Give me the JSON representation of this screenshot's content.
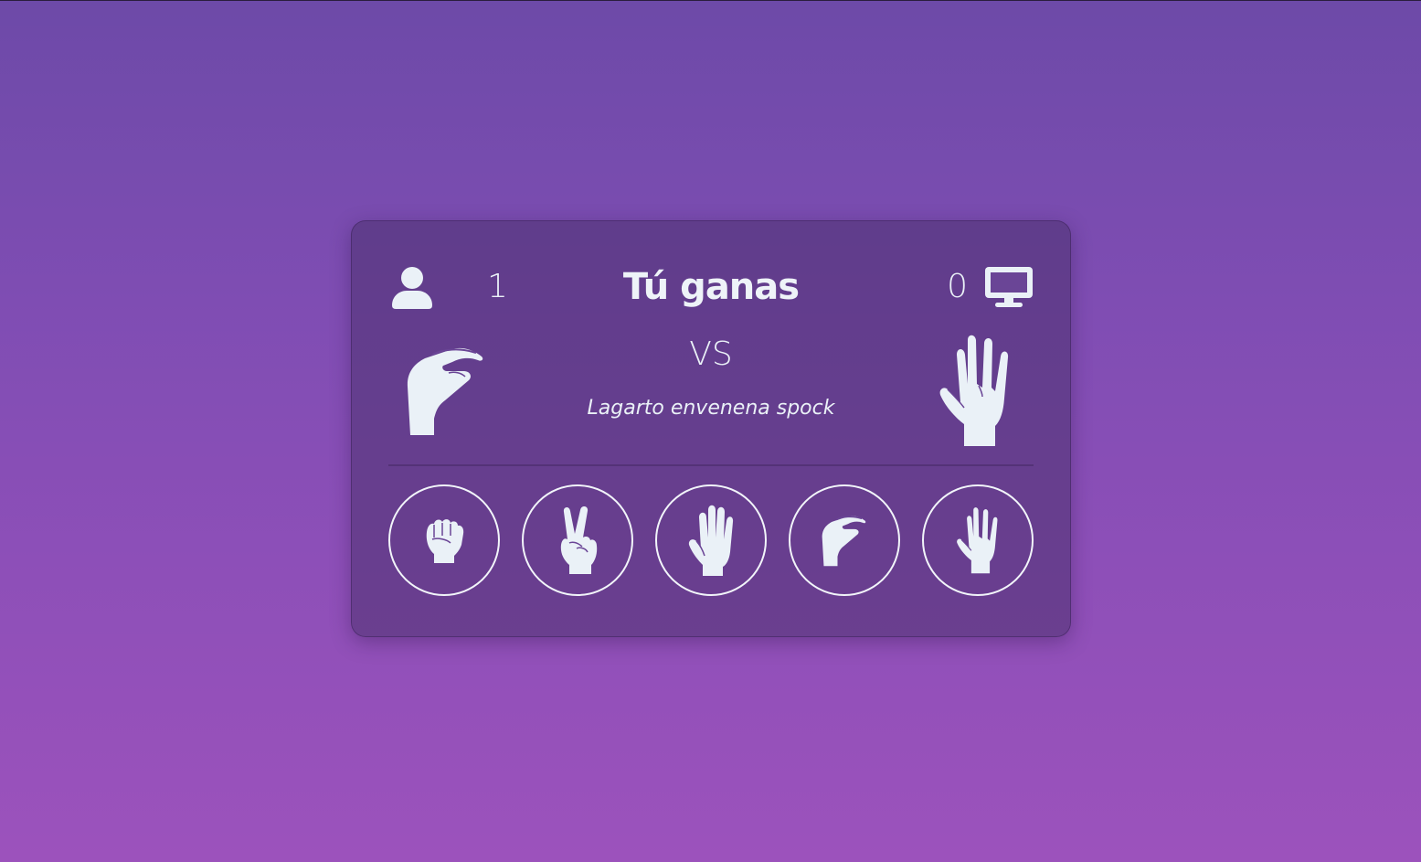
{
  "scoreboard": {
    "player_score": "1",
    "result_text": "Tú ganas",
    "cpu_score": "0",
    "player_icon": "user-icon",
    "cpu_icon": "monitor-icon"
  },
  "battle": {
    "player_choice": "lizard",
    "cpu_choice": "spock",
    "vs_label": "VS",
    "message": "Lagarto envenena spock"
  },
  "choices": [
    {
      "id": "rock",
      "icon": "hand-rock-icon"
    },
    {
      "id": "scissors",
      "icon": "hand-scissors-icon"
    },
    {
      "id": "paper",
      "icon": "hand-paper-icon"
    },
    {
      "id": "lizard",
      "icon": "hand-lizard-icon"
    },
    {
      "id": "spock",
      "icon": "hand-spock-icon"
    }
  ],
  "colors": {
    "background_top": "#6d4aa8",
    "background_bottom": "#9c52bc",
    "card": "#5e4084",
    "icon": "#eaf1f7"
  }
}
